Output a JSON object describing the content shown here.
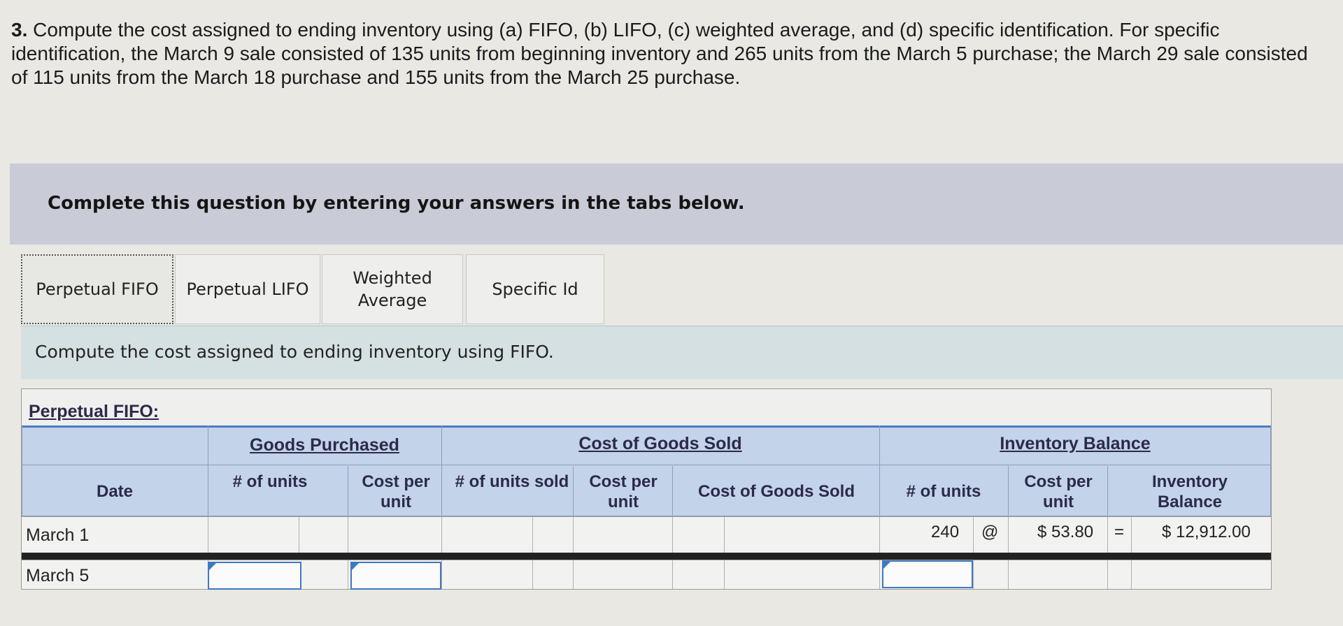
{
  "question": {
    "number": "3.",
    "text": "Compute the cost assigned to ending inventory using (a) FIFO, (b) LIFO, (c) weighted average, and (d) specific identification. For specific identification, the March 9 sale consisted of 135 units from beginning inventory and 265 units from the March 5 purchase; the March 29 sale consisted of 115 units from the March 18 purchase and 155 units from the March 25 purchase."
  },
  "banner": {
    "text": "Complete this question by entering your answers in the tabs below."
  },
  "tabs": [
    {
      "label": "Perpetual FIFO",
      "active": true
    },
    {
      "label": "Perpetual LIFO",
      "active": false
    },
    {
      "label": "Weighted Average",
      "active": false
    },
    {
      "label": "Specific Id",
      "active": false
    }
  ],
  "instruction": "Compute the cost assigned to ending inventory using FIFO.",
  "table": {
    "title": "Perpetual FIFO:",
    "groups": {
      "purchased": "Goods Purchased",
      "cogs": "Cost of Goods Sold",
      "balance": "Inventory Balance"
    },
    "columns": {
      "date": "Date",
      "units": "# of units",
      "cost_per_unit": "Cost per unit",
      "units_sold": "# of units sold",
      "cogs": "Cost of Goods Sold",
      "bal_units": "# of units",
      "inv_balance": "Inventory Balance"
    },
    "rows": [
      {
        "date": "March 1",
        "bal_units": "240",
        "at": "@",
        "bal_cost": "$ 53.80",
        "eq": "=",
        "bal_total": "$ 12,912.00"
      },
      {
        "date": "March 5"
      }
    ]
  }
}
